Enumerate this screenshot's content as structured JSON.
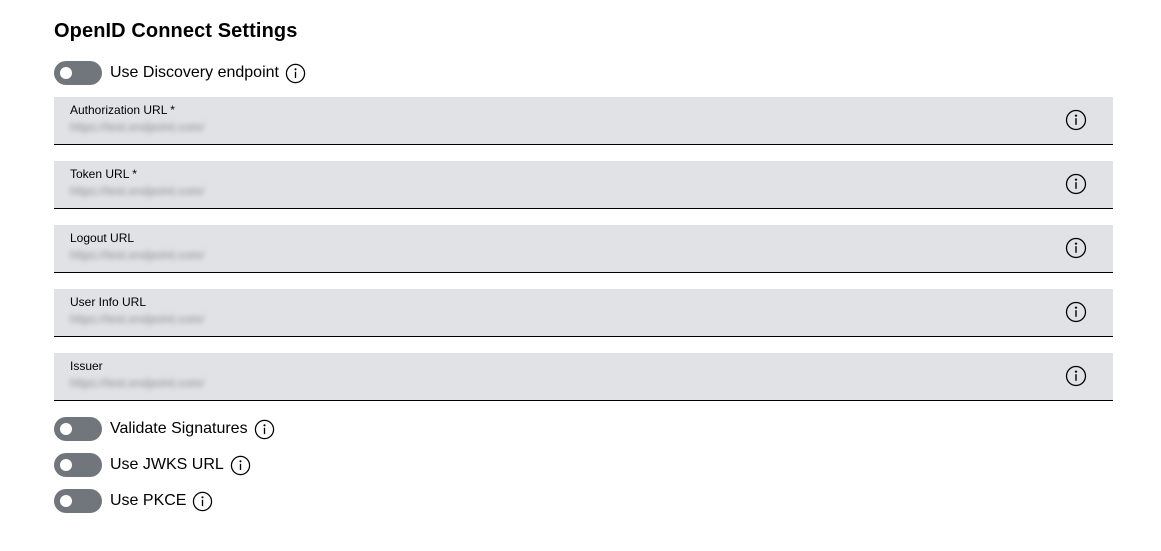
{
  "section": {
    "title": "OpenID Connect Settings"
  },
  "discovery_toggle": {
    "label": "Use Discovery endpoint",
    "enabled": false,
    "info_icon": "info-icon"
  },
  "fields": [
    {
      "label": "Authorization URL *",
      "value": "https://test.endpoint.com/",
      "info_icon": "info-icon"
    },
    {
      "label": "Token URL *",
      "value": "https://test.endpoint.com/",
      "info_icon": "info-icon"
    },
    {
      "label": "Logout URL",
      "value": "https://test.endpoint.com/",
      "info_icon": "info-icon"
    },
    {
      "label": "User Info URL",
      "value": "https://test.endpoint.com/",
      "info_icon": "info-icon"
    },
    {
      "label": "Issuer",
      "value": "https://test.endpoint.com/",
      "info_icon": "info-icon"
    }
  ],
  "bottom_toggles": [
    {
      "label": "Validate Signatures",
      "enabled": false,
      "info_icon": "info-icon"
    },
    {
      "label": "Use JWKS URL",
      "enabled": false,
      "info_icon": "info-icon"
    },
    {
      "label": "Use PKCE",
      "enabled": false,
      "info_icon": "info-icon"
    }
  ],
  "colors": {
    "toggle_off": "#71767c",
    "field_background": "#e0e2e5",
    "field_underline": "#000000",
    "text": "#000000"
  }
}
